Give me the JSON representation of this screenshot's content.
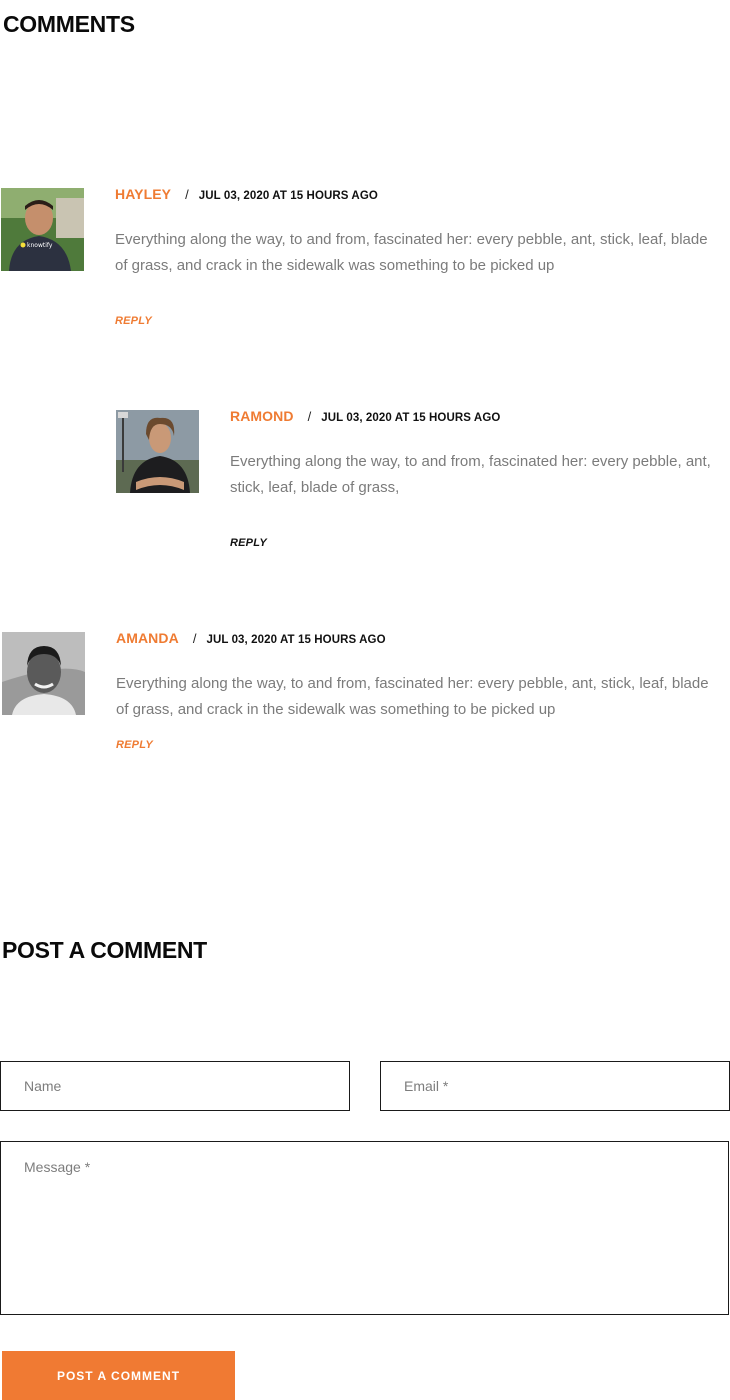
{
  "comments_section": {
    "title": "COMMENTS"
  },
  "comments": [
    {
      "author": "HAYLEY",
      "separator": "/",
      "date": "JUL 03, 2020 AT 15 HOURS AGO",
      "text": "Everything along the way, to and from, fascinated her: every pebble, ant, stick, leaf, blade of grass, and crack in the sidewalk was something to be picked up",
      "reply_label": "REPLY",
      "avatar_shirt_text": "knowtify"
    },
    {
      "author": "RAMOND",
      "separator": "/",
      "date": "JUL 03, 2020 AT 15 HOURS AGO",
      "text": "Everything along the way, to and from, fascinated her: every pebble, ant, stick, leaf, blade of grass,",
      "reply_label": "REPLY"
    },
    {
      "author": "AMANDA",
      "separator": "/",
      "date": "JUL 03, 2020 AT 15 HOURS AGO",
      "text": "Everything along the way, to and from, fascinated her: every pebble, ant, stick, leaf, blade of grass, and crack in the sidewalk was something to be picked up",
      "reply_label": "REPLY"
    }
  ],
  "comment_form": {
    "title": "POST A COMMENT",
    "name_placeholder": "Name",
    "email_placeholder": "Email *",
    "message_placeholder": "Message *",
    "submit_label": "POST A COMMENT"
  },
  "colors": {
    "accent": "#ef7b32",
    "text_muted": "#7b7b7b",
    "heading": "#0a0a0a"
  }
}
